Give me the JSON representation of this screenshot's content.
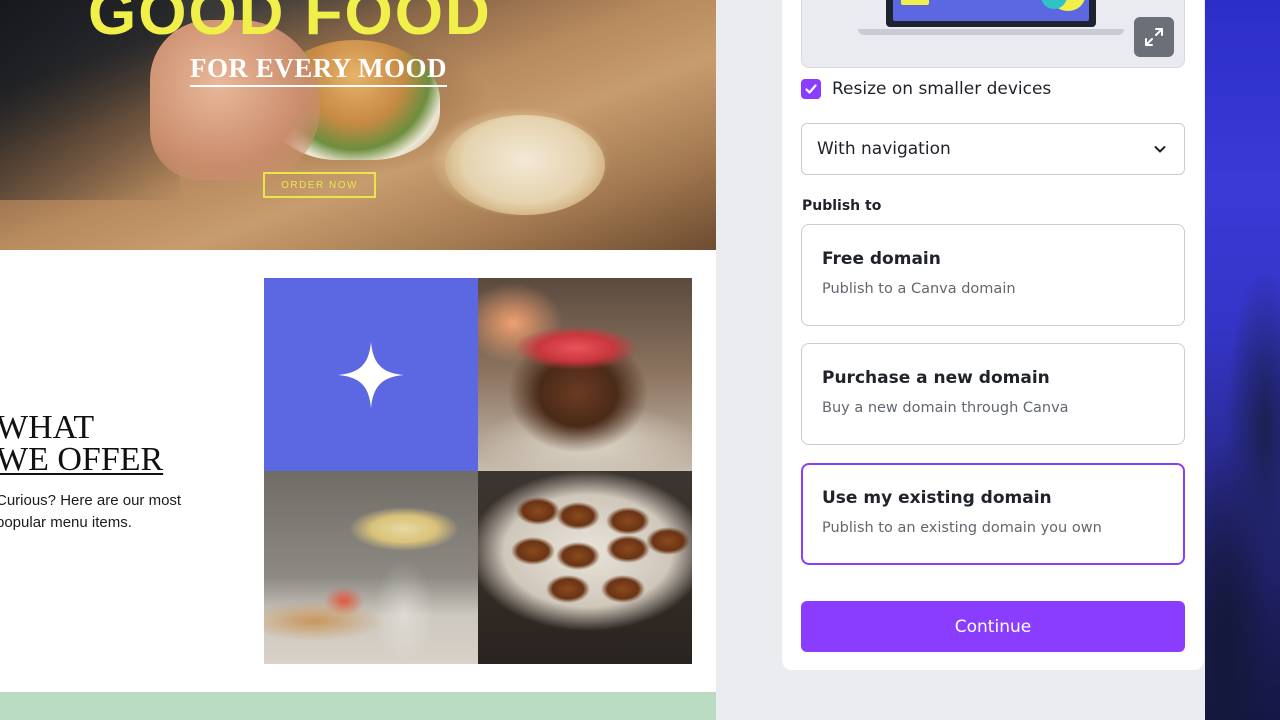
{
  "website": {
    "hero_title": "GOOD FOOD",
    "hero_subtitle": "FOR EVERY MOOD",
    "order_button": "ORDER NOW",
    "offer_title_line1": "WHAT",
    "offer_title_line2": "WE OFFER",
    "offer_text": "Curious? Here are our most popular menu items."
  },
  "publish_panel": {
    "resize_label": "Resize on smaller devices",
    "resize_checked": true,
    "navigation_select": "With navigation",
    "publish_to_heading": "Publish to",
    "options": [
      {
        "title": "Free domain",
        "description": "Publish to a Canva domain"
      },
      {
        "title": "Purchase a new domain",
        "description": "Buy a new domain through Canva"
      },
      {
        "title": "Use my existing domain",
        "description": "Publish to an existing domain you own",
        "selected": true
      }
    ],
    "continue_label": "Continue"
  },
  "colors": {
    "accent": "#8b3dff",
    "hero_yellow": "#f1f04a",
    "tile_blue": "#5c68e2",
    "footer_green": "#b9dcc3"
  },
  "icons": [
    "sparkle-star-icon",
    "expand-icon",
    "checkmark-icon",
    "chevron-down-icon"
  ]
}
